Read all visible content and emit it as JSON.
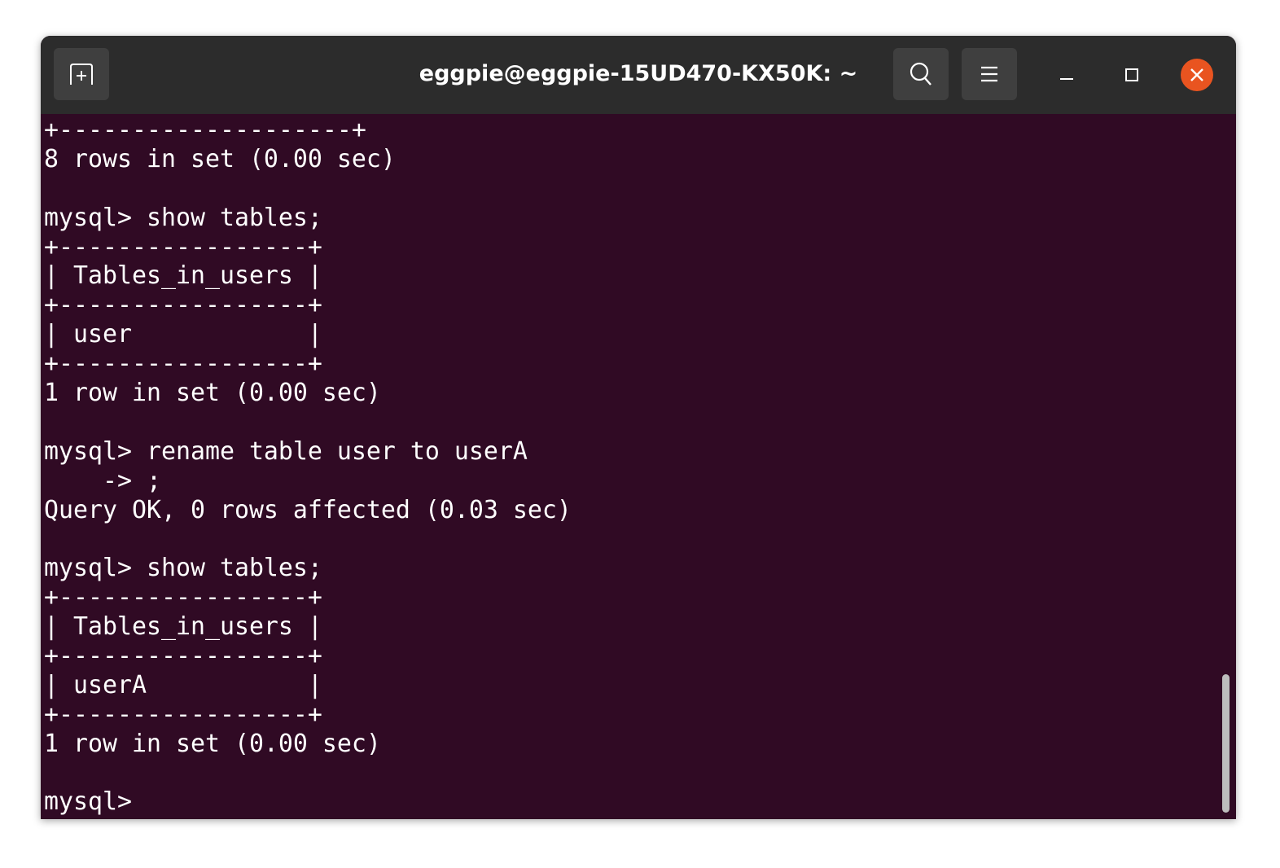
{
  "window": {
    "title": "eggpie@eggpie-15UD470-KX50K: ~",
    "buttons": [
      "new-tab",
      "search",
      "menu",
      "minimize",
      "maximize",
      "close"
    ],
    "accent_close": "#e95420",
    "terminal_bg": "#300a24"
  },
  "terminal": {
    "lines": [
      "+--------------------+",
      "8 rows in set (0.00 sec)",
      "",
      "mysql> show tables;",
      "+-----------------+",
      "| Tables_in_users |",
      "+-----------------+",
      "| user            |",
      "+-----------------+",
      "1 row in set (0.00 sec)",
      "",
      "mysql> rename table user to userA",
      "    -> ;",
      "Query OK, 0 rows affected (0.03 sec)",
      "",
      "mysql> show tables;",
      "+-----------------+",
      "| Tables_in_users |",
      "+-----------------+",
      "| userA           |",
      "+-----------------+",
      "1 row in set (0.00 sec)",
      "",
      "mysql> "
    ]
  }
}
